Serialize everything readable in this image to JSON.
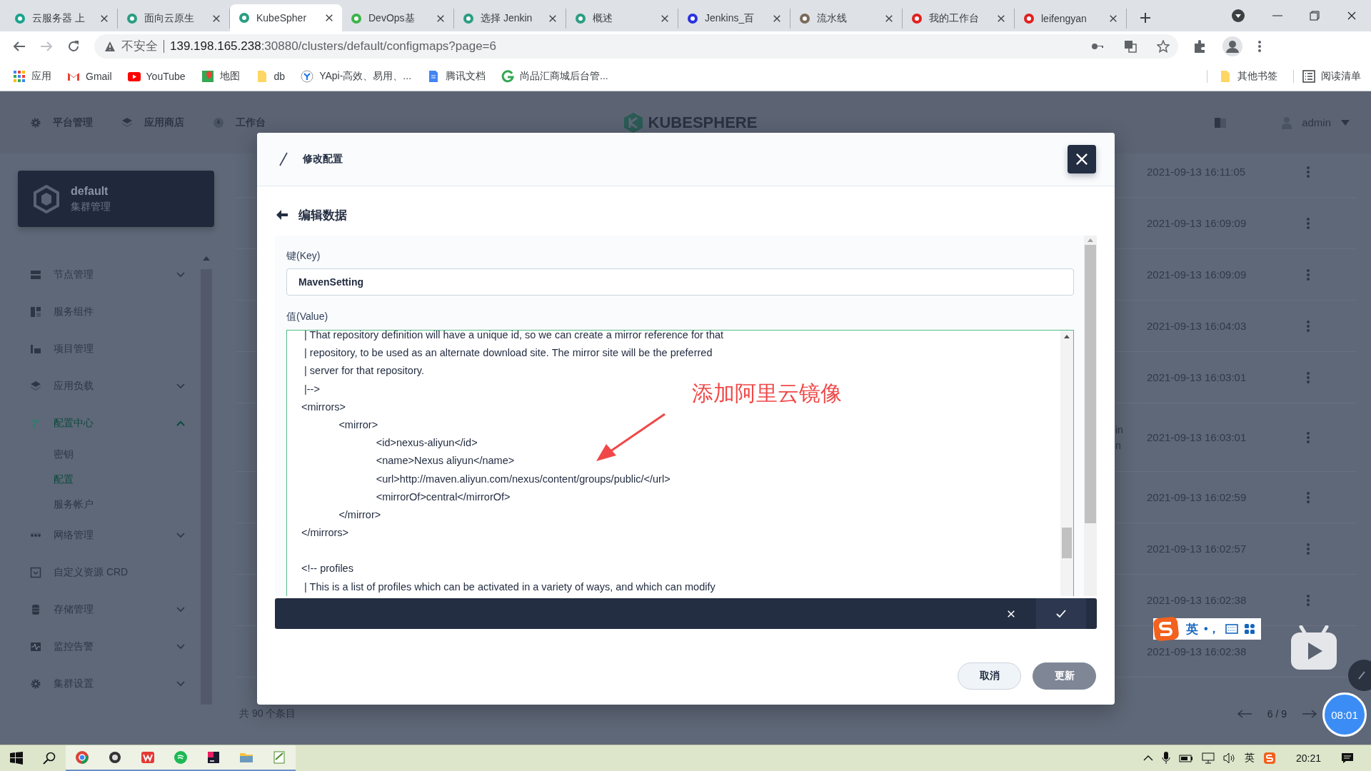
{
  "browser": {
    "tabs": [
      {
        "title": "云服务器 上",
        "selected": false
      },
      {
        "title": "面向云原生",
        "selected": false
      },
      {
        "title": "KubeSpher",
        "selected": true
      },
      {
        "title": "DevOps基",
        "selected": false
      },
      {
        "title": "选择 Jenkin",
        "selected": false
      },
      {
        "title": "概述",
        "selected": false
      },
      {
        "title": "Jenkins_百",
        "selected": false
      },
      {
        "title": "流水线",
        "selected": false
      },
      {
        "title": "我的工作台",
        "selected": false
      },
      {
        "title": "leifengyan",
        "selected": false
      }
    ],
    "security": "不安全",
    "url_host": "139.198.165.238",
    "url_path": ":30880/clusters/default/configmaps?page=6",
    "bookmarks": [
      "应用",
      "Gmail",
      "YouTube",
      "地图",
      "db",
      "YApi-高效、易用、...",
      "腾讯文档",
      "尚品汇商城后台管..."
    ],
    "other_bookmarks": "其他书签",
    "reading_list": "阅读清单"
  },
  "header": {
    "nav": [
      "平台管理",
      "应用商店",
      "工作台"
    ],
    "logo": "KUBESPHERE",
    "user": "admin"
  },
  "sidebar": {
    "cluster": {
      "name": "default",
      "subtitle": "集群管理"
    },
    "items": [
      {
        "label": "节点管理",
        "kind": "group",
        "expanded": false,
        "selected": false
      },
      {
        "label": "服务组件",
        "kind": "link",
        "selected": false
      },
      {
        "label": "项目管理",
        "kind": "link",
        "selected": false
      },
      {
        "label": "应用负载",
        "kind": "group",
        "expanded": false,
        "selected": false
      },
      {
        "label": "配置中心",
        "kind": "group",
        "expanded": true,
        "selected": true,
        "children": [
          {
            "label": "密钥",
            "selected": false
          },
          {
            "label": "配置",
            "selected": true
          },
          {
            "label": "服务帐户",
            "selected": false
          }
        ]
      },
      {
        "label": "网络管理",
        "kind": "group",
        "expanded": false,
        "selected": false
      },
      {
        "label": "自定义资源 CRD",
        "kind": "link",
        "selected": false
      },
      {
        "label": "存储管理",
        "kind": "group",
        "expanded": false,
        "selected": false
      },
      {
        "label": "监控告警",
        "kind": "group",
        "expanded": false,
        "selected": false
      },
      {
        "label": "集群设置",
        "kind": "group",
        "expanded": false,
        "selected": false
      }
    ]
  },
  "table": {
    "rows": [
      {
        "created": "2021-09-13 16:11:05"
      },
      {
        "created": "2021-09-13 16:09:09"
      },
      {
        "created": "2021-09-13 16:09:09"
      },
      {
        "created": "2021-09-13 16:04:03"
      },
      {
        "created": "2021-09-13 16:03:01"
      },
      {
        "column_1": [
          "in",
          "n"
        ],
        "created": "2021-09-13 16:03:01"
      },
      {
        "created": "2021-09-13 16:02:59"
      },
      {
        "created": "2021-09-13 16:02:57"
      },
      {
        "created": "2021-09-13 16:02:38"
      },
      {
        "created": "2021-09-13 16:02:38"
      }
    ],
    "total": "共 90 个条目",
    "page": "6 / 9"
  },
  "modal": {
    "title": "修改配置",
    "section": "编辑数据",
    "key_label": "键(Key)",
    "key_value": "MavenSetting",
    "value_label": "值(Value)",
    "code": " | That repository definition will have a unique id, so we can create a mirror reference for that\n | repository, to be used as an alternate download site. The mirror site will be the preferred\n | server for that repository.\n |-->\n<mirrors>\n\t<mirror>\n\t\t<id>nexus-aliyun</id>\n\t\t<name>Nexus aliyun</name>\n\t\t<url>http://maven.aliyun.com/nexus/content/groups/public/</url>\n\t\t<mirrorOf>central</mirrorOf>\n\t</mirror>\n</mirrors>\n\n<!-- profiles\n | This is a list of profiles which can be activated in a variety of ways, and which can modify",
    "annotation": "添加阿里云镜像",
    "cancel": "取消",
    "submit": "更新"
  },
  "overlays": {
    "ime_lang": "英",
    "ime_punct": "•，",
    "timer": "08:01"
  },
  "taskbar": {
    "ime": "英",
    "time": "20:21"
  }
}
